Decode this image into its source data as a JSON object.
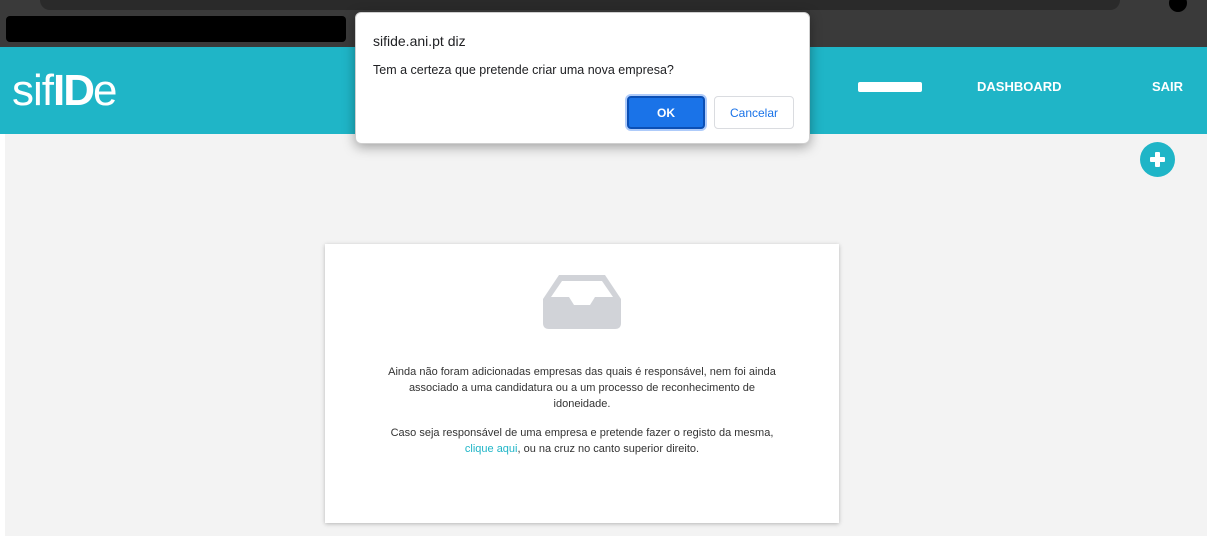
{
  "header": {
    "logo_prefix": "sif",
    "logo_bold": "ID",
    "logo_suffix": "e",
    "nav": {
      "dashboard": "DASHBOARD",
      "sair": "SAIR"
    },
    "accent_color": "#1fb5c7"
  },
  "main": {
    "add_button_icon": "plus-circle-icon",
    "empty_icon": "inbox-icon",
    "empty_text_1": "Ainda não foram adicionadas empresas das quais é responsável, nem foi ainda associado a uma candidatura ou a um processo de reconhecimento de idoneidade.",
    "empty_text_2_before": "Caso seja responsável de uma empresa e pretende fazer o registo da mesma, ",
    "empty_text_2_link": "clique aqui",
    "empty_text_2_after": ", ou na cruz no canto superior direito."
  },
  "dialog": {
    "title": "sifide.ani.pt diz",
    "message": "Tem a certeza que pretende criar uma nova empresa?",
    "ok_label": "OK",
    "cancel_label": "Cancelar",
    "ok_color": "#1a73e8"
  }
}
